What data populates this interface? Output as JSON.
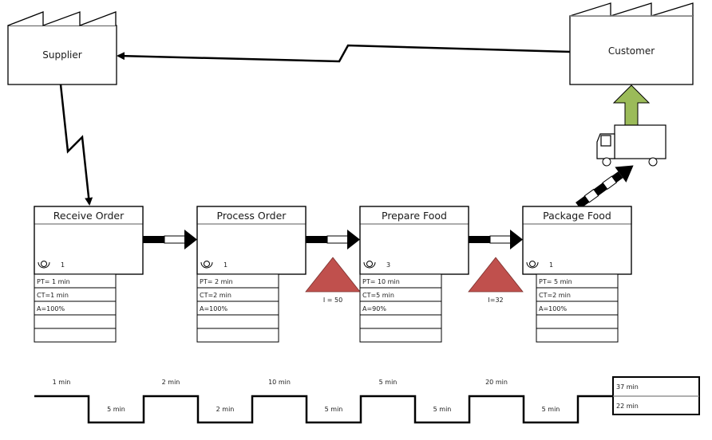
{
  "diagram": {
    "type": "value-stream-map",
    "supplier": {
      "label": "Supplier"
    },
    "customer": {
      "label": "Customer"
    },
    "colors": {
      "inventory": "#c0504d",
      "shipment_arrow": "#9bbb59",
      "line": "#000000",
      "header_border": "#7f7f7f"
    },
    "processes": [
      {
        "title": "Receive Order",
        "operators": "1",
        "data": [
          "PT= 1 min",
          "CT=1 min",
          "A=100%",
          "",
          ""
        ]
      },
      {
        "title": "Process Order",
        "operators": "1",
        "data": [
          "PT= 2 min",
          "CT=2 min",
          "A=100%",
          "",
          ""
        ]
      },
      {
        "title": "Prepare Food",
        "operators": "3",
        "data": [
          "PT= 10 min",
          "CT=5 min",
          "A=90%",
          "",
          ""
        ]
      },
      {
        "title": "Package Food",
        "operators": "1",
        "data": [
          "PT= 5 min",
          "CT=2 min",
          "A=100%",
          "",
          ""
        ]
      }
    ],
    "inventory": [
      {
        "label": "I = 50",
        "between": [
          "Process Order",
          "Prepare Food"
        ]
      },
      {
        "label": "I=32",
        "between": [
          "Prepare Food",
          "Package Food"
        ]
      }
    ],
    "timeline": {
      "top": [
        "1 min",
        "2 min",
        "10 min",
        "5 min",
        "20 min"
      ],
      "bottom": [
        "5 min",
        "2 min",
        "5 min",
        "5 min",
        "5 min"
      ],
      "totals": {
        "top": "37 min",
        "bottom": "22 min"
      }
    }
  }
}
